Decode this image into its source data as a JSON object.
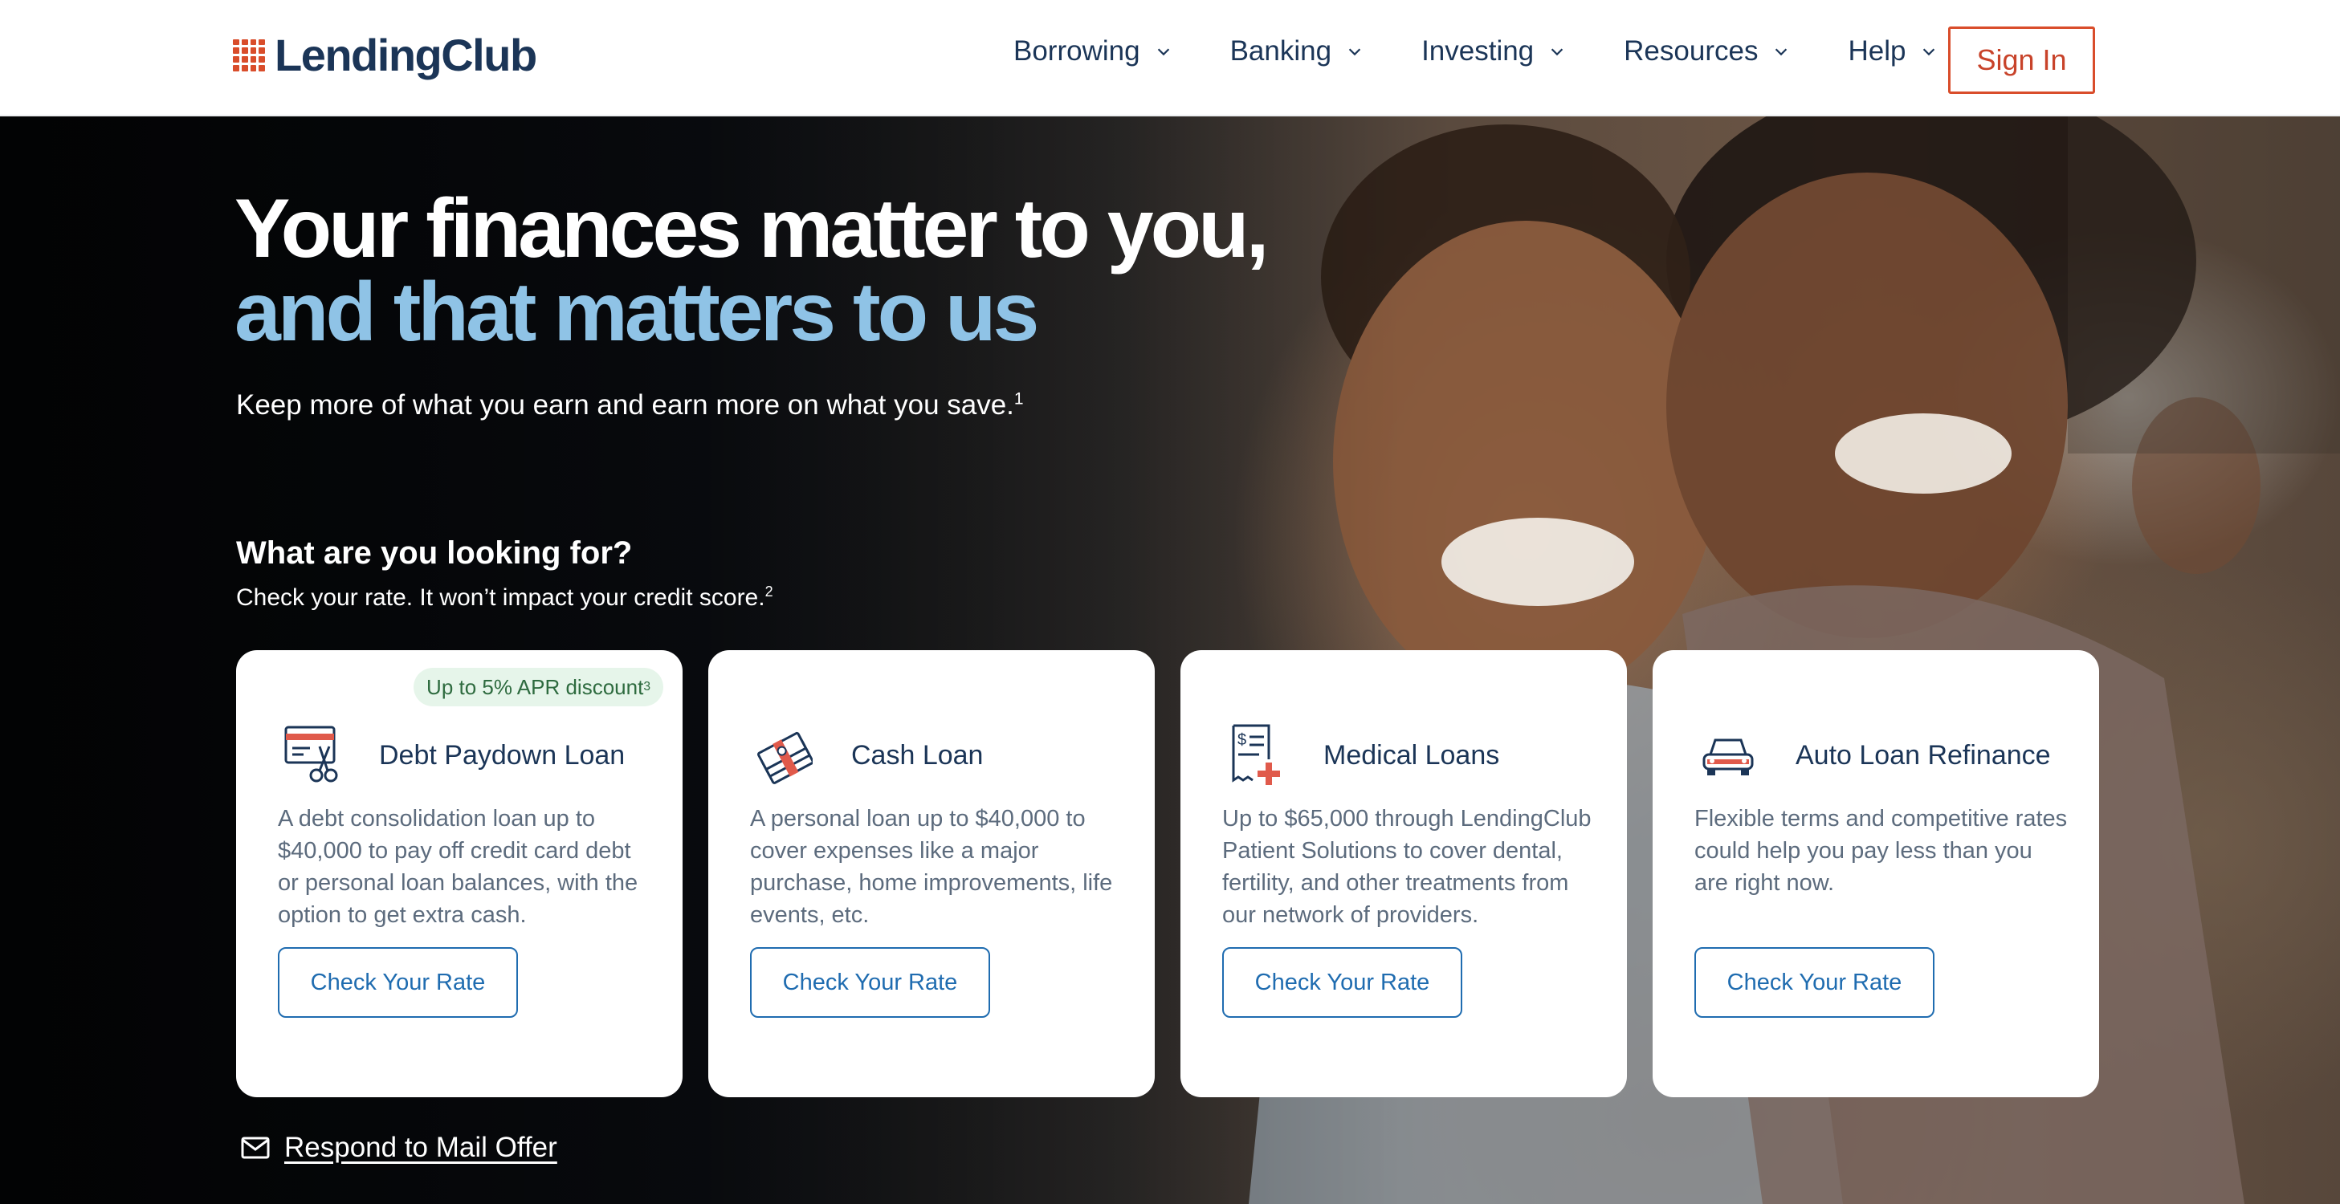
{
  "header": {
    "logo_text": "LendingClub",
    "nav": [
      {
        "label": "Borrowing"
      },
      {
        "label": "Banking"
      },
      {
        "label": "Investing"
      },
      {
        "label": "Resources"
      },
      {
        "label": "Help"
      }
    ],
    "sign_in_label": "Sign In"
  },
  "hero": {
    "headline_line1": "Your finances matter to you,",
    "headline_line2": "and that matters to us",
    "subtext": "Keep more of what you earn and earn more on what you save.",
    "subtext_footnote": "1",
    "looking_for_title": "What are you looking for?",
    "looking_for_sub": "Check your rate. It won’t impact your credit score.",
    "looking_for_footnote": "2"
  },
  "cards": [
    {
      "badge": "Up to 5% APR discount",
      "badge_footnote": "3",
      "icon": "debt-paydown-icon",
      "title": "Debt Paydown Loan",
      "description": "A debt consolidation loan up to $40,000 to pay off credit card debt or personal loan balances, with the option to get extra cash.",
      "button": "Check Your Rate"
    },
    {
      "icon": "cash-icon",
      "title": "Cash Loan",
      "description": "A personal loan up to $40,000 to cover expenses like a major purchase, home improvements, life events, etc.",
      "button": "Check Your Rate"
    },
    {
      "icon": "medical-bill-icon",
      "title": "Medical Loans",
      "description": "Up to $65,000 through LendingClub Patient Solutions to cover dental, fertility, and other treatments from our network of providers.",
      "button": "Check Your Rate"
    },
    {
      "icon": "car-icon",
      "title": "Auto Loan Refinance",
      "description": "Flexible terms and competitive rates could help you pay less than you are right now.",
      "button": "Check Your Rate"
    }
  ],
  "mail_offer_label": "Respond to Mail Offer",
  "colors": {
    "brand_navy": "#1b3557",
    "brand_orange": "#d94d2b",
    "accent_blue": "#1f6cb0",
    "headline_blue": "#8fc3e6",
    "badge_bg": "#e6f5ea"
  }
}
